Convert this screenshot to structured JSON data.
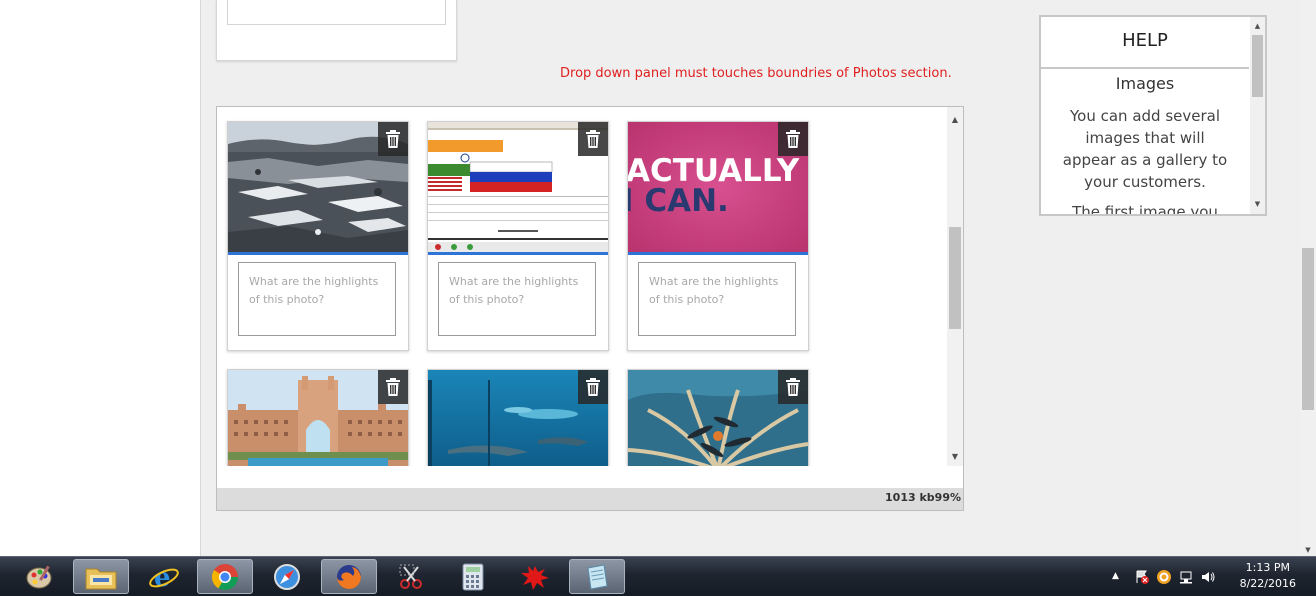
{
  "notice": "Drop down panel must touches boundries of Photos section.",
  "photos": {
    "caption_placeholder": "What are the highlights of this photo?",
    "footer_size": "1013 kb99%",
    "items": [
      {
        "name": "snowy-rocks-photo"
      },
      {
        "name": "flags-screenshot-photo",
        "overlay_text": ""
      },
      {
        "name": "actually-i-can-photo",
        "overlay_text_1": "ACTUALLY",
        "overlay_text_2": "I CAN."
      },
      {
        "name": "atlantis-hotel-photo"
      },
      {
        "name": "underwater-aquarium-photo"
      },
      {
        "name": "palm-island-skydivers-photo"
      }
    ]
  },
  "help": {
    "title": "HELP",
    "subtitle": "Images",
    "body": "You can add several images that will appear as a gallery to your customers.",
    "body_cont": "The first image you"
  },
  "taskbar": {
    "apps": [
      "paint",
      "file-explorer",
      "internet-explorer",
      "chrome",
      "safari",
      "firefox",
      "snipping-tool",
      "calculator",
      "splat-app",
      "notepad-app"
    ],
    "clock_time": "1:13 PM",
    "clock_date": "8/22/2016"
  },
  "colors": {
    "accent_blue": "#2e74d6",
    "notice_red": "#e02020"
  }
}
